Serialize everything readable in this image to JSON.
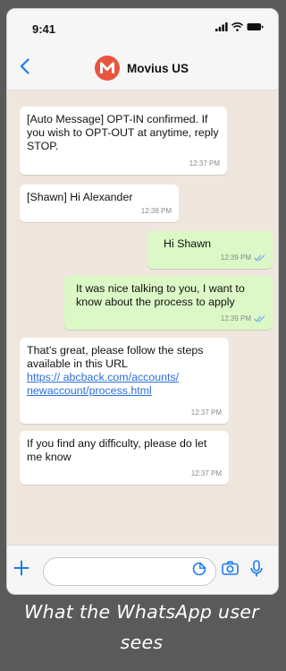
{
  "status_bar": {
    "time": "9:41"
  },
  "header": {
    "back_icon": "chevron-left-icon",
    "contact_name": "Movius US",
    "brand_color": "#e8553e"
  },
  "messages": [
    {
      "direction": "incoming",
      "text": "[Auto Message] OPT-IN confirmed. If you wish to OPT-OUT at anytime, reply STOP.",
      "time": "12:37 PM"
    },
    {
      "direction": "incoming",
      "text": "[Shawn] Hi Alexander",
      "time": "12:38 PM"
    },
    {
      "direction": "outgoing",
      "text": "Hi Shawn",
      "time": "12:39 PM",
      "read": true
    },
    {
      "direction": "outgoing",
      "text": "It was nice talking to you, I want to know about the process to apply",
      "time": "12:39 PM",
      "read": true
    },
    {
      "direction": "incoming",
      "text": "That’s great, please follow the steps available in this URL",
      "link": "https:// abcback.com/accounts/ newaccount/process.html",
      "time": "12:37 PM"
    },
    {
      "direction": "incoming",
      "text": "If you find any difficulty, please do let me know",
      "time": "12:37 PM"
    }
  ],
  "input_bar": {
    "message_value": "",
    "icons": [
      "plus-icon",
      "sticker-icon",
      "camera-icon",
      "microphone-icon"
    ]
  },
  "caption": "What the WhatsApp user sees",
  "colors": {
    "incoming_bubble": "#ffffff",
    "outgoing_bubble": "#dcf8c6",
    "accent": "#1a7cf0",
    "chat_background": "#efe7dd"
  }
}
